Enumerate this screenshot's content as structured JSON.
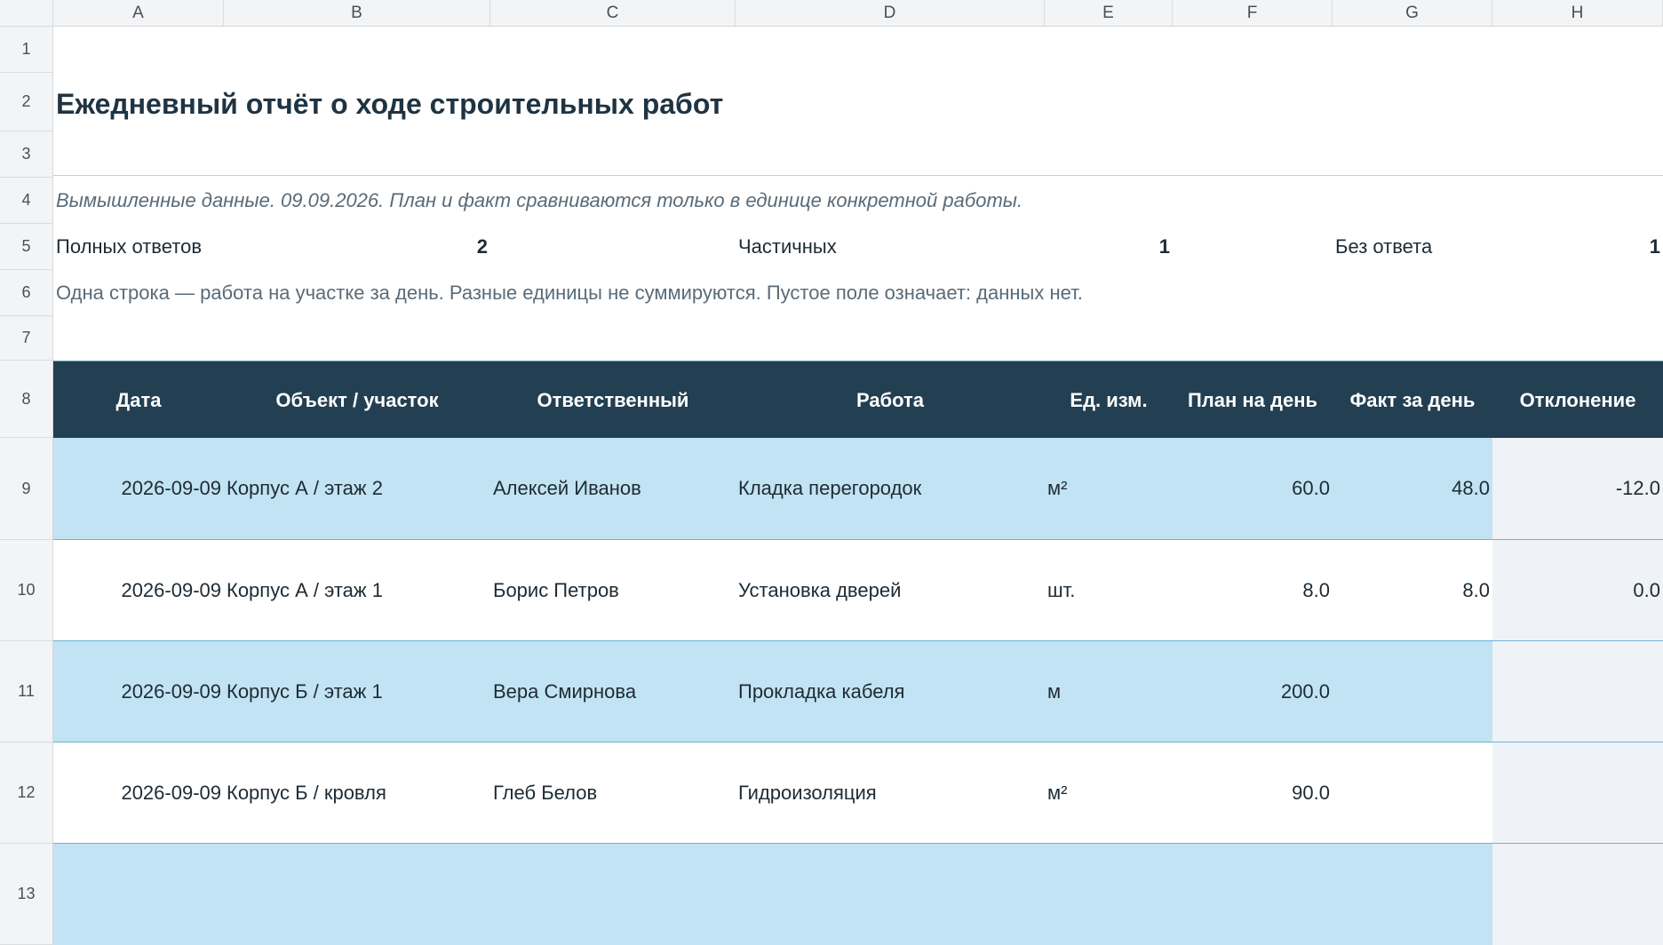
{
  "columns": [
    "A",
    "B",
    "C",
    "D",
    "E",
    "F",
    "G",
    "H"
  ],
  "rows": [
    "1",
    "2",
    "3",
    "4",
    "5",
    "6",
    "7",
    "8",
    "9",
    "10",
    "11",
    "12",
    "13"
  ],
  "title": "Ежедневный отчёт о ходе строительных работ",
  "note": "Вымышленные данные. 09.09.2026. План и факт сравниваются только в единице конкретной работы.",
  "stats": {
    "full_label": "Полных ответов",
    "full_value": "2",
    "partial_label": "Частичных",
    "partial_value": "1",
    "none_label": "Без ответа",
    "none_value": "1"
  },
  "info": "Одна строка — работа на участке за день. Разные единицы не суммируются. Пустое поле означает: данных нет.",
  "table": {
    "headers": [
      "Дата",
      "Объект / участок",
      "Ответственный",
      "Работа",
      "Ед. изм.",
      "План на день",
      "Факт за день",
      "Отклонение"
    ],
    "rows": [
      [
        "2026-09-09",
        "Корпус А / этаж 2",
        "Алексей Иванов",
        "Кладка перегородок",
        "м²",
        "60.0",
        "48.0",
        "-12.0"
      ],
      [
        "2026-09-09",
        "Корпус А / этаж 1",
        "Борис Петров",
        "Установка дверей",
        "шт.",
        "8.0",
        "8.0",
        "0.0"
      ],
      [
        "2026-09-09",
        "Корпус Б / этаж 1",
        "Вера Смирнова",
        "Прокладка кабеля",
        "м",
        "200.0",
        "",
        ""
      ],
      [
        "2026-09-09",
        "Корпус Б / кровля",
        "Глеб Белов",
        "Гидроизоляция",
        "м²",
        "90.0",
        "",
        ""
      ]
    ]
  },
  "colors": {
    "header_bg": "#233f52",
    "band": "#c2e3f3",
    "calc_col": "#eff2f6",
    "title": "#1f3442",
    "muted": "#5a6b78"
  }
}
